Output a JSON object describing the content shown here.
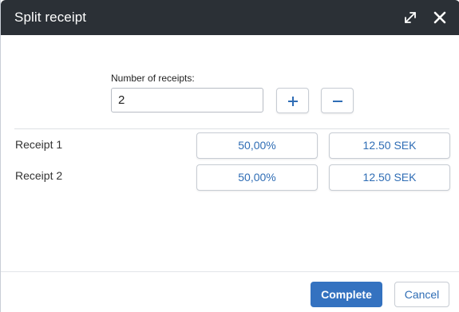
{
  "dialog": {
    "title": "Split receipt"
  },
  "receipts_count": {
    "label": "Number of receipts:",
    "value": "2"
  },
  "receipts": [
    {
      "label": "Receipt 1",
      "percent": "50,00%",
      "amount": "12.50 SEK"
    },
    {
      "label": "Receipt 2",
      "percent": "50,00%",
      "amount": "12.50 SEK"
    }
  ],
  "footer": {
    "complete_label": "Complete",
    "cancel_label": "Cancel"
  },
  "icons": {
    "expand": "expand-icon",
    "close": "close-icon",
    "plus": "plus-icon",
    "minus": "minus-icon"
  },
  "colors": {
    "titlebar": "#2b3036",
    "accent": "#3472c0",
    "link_text": "#2f6db5"
  }
}
